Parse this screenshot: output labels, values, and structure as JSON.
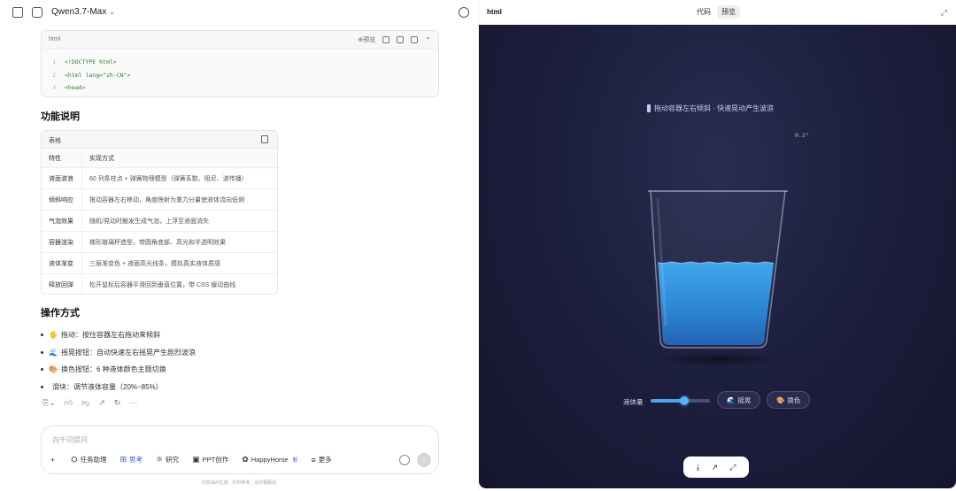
{
  "header": {
    "model_name": "Qwen3.7-Max"
  },
  "code_card": {
    "lang": "html",
    "preview_label": "预览",
    "lines": [
      {
        "n": "1",
        "text": "<!DOCTYPE html>"
      },
      {
        "n": "2",
        "text": "<html lang=\"zh-CN\">"
      },
      {
        "n": "3",
        "text": "<head>"
      }
    ]
  },
  "features": {
    "title": "功能说明",
    "table_label": "表格",
    "columns": [
      "特性",
      "实现方式"
    ],
    "rows": [
      [
        "液面波浪",
        "60 列条柱点 + 弹簧物理模型（弹簧系数、阻尼、波传播）"
      ],
      [
        "倾斜响应",
        "拖动容器左右移动，角度映射为重力分量使液体流向低侧"
      ],
      [
        "气泡效果",
        "随机/晃动时触发生成气泡，上浮至液面消失"
      ],
      [
        "容器渲染",
        "梯形玻璃杯造型，带圆角底部、高光和半透明效果"
      ],
      [
        "液体渐变",
        "三层渐变色 + 液面高光线条，模拟真实液体质感"
      ],
      [
        "释放回弹",
        "松开鼠标后容器平滑回到垂直位置，带 CSS 缓动曲线"
      ]
    ]
  },
  "operations": {
    "title": "操作方式",
    "items": [
      {
        "emoji": "🖐",
        "text": "拖动：按住容器左右拖动来倾斜"
      },
      {
        "emoji": "🌊",
        "text": "摇晃按钮：自动快速左右摇晃产生剧烈波浪"
      },
      {
        "emoji": "🎨",
        "text": "换色按钮：6 种液体颜色主题切换"
      },
      {
        "emoji": "",
        "text": "滑块：调节液体容量（20%~85%）"
      }
    ]
  },
  "composer": {
    "placeholder": "向千问提问",
    "tools": [
      {
        "icon": "+",
        "label": ""
      },
      {
        "icon": "⛭",
        "label": "任务助理"
      },
      {
        "icon": "⊞",
        "label": "思考"
      },
      {
        "icon": "⚛",
        "label": "研究"
      },
      {
        "icon": "▣",
        "label": "PPT创作"
      },
      {
        "icon": "✿",
        "label": "HappyHorse"
      },
      {
        "icon": "≡",
        "label": "更多"
      }
    ],
    "new_badge": "新",
    "disclaimer": "内容由AI生成，仅供参考，请仔细甄别"
  },
  "preview": {
    "title": "html",
    "tabs": [
      "代码",
      "预览"
    ],
    "active_tab": 1,
    "hint": "拖动容器左右倾斜 · 快速晃动产生波浪",
    "tilt_readout": "0.2°",
    "fill_level": 0.35,
    "liquid_color": "#2a8fdc",
    "volume_label": "液体量",
    "volume_value": 0.5,
    "shake_label": "摇晃",
    "color_label": "换色"
  }
}
